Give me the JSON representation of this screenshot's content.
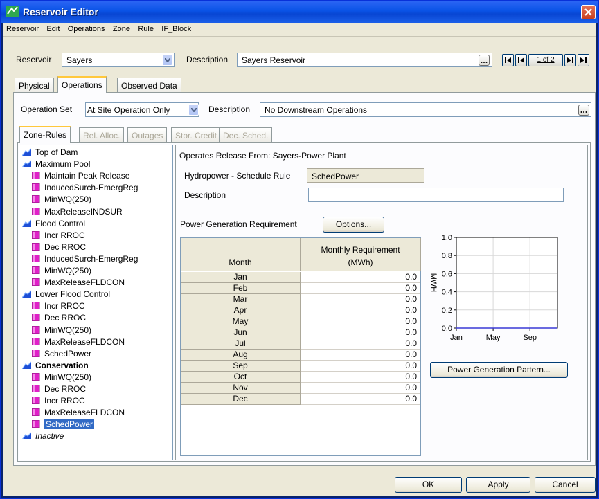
{
  "window": {
    "title": "Reservoir Editor"
  },
  "menu": [
    "Reservoir",
    "Edit",
    "Operations",
    "Zone",
    "Rule",
    "IF_Block"
  ],
  "reservoir": {
    "label": "Reservoir",
    "value": "Sayers",
    "description_label": "Description",
    "description_value": "Sayers Reservoir",
    "nav": {
      "first": "⏮",
      "prev": "◀",
      "page": "1 of 2",
      "next": "▶",
      "last": "⏭"
    }
  },
  "main_tabs": [
    {
      "label": "Physical",
      "active": false
    },
    {
      "label": "Operations",
      "active": true
    },
    {
      "label": "Observed Data",
      "active": false
    }
  ],
  "operation_set": {
    "label": "Operation Set",
    "value": "At Site Operation Only",
    "description_label": "Description",
    "description_value": "No Downstream Operations"
  },
  "sub_tabs": [
    {
      "label": "Zone-Rules",
      "active": true,
      "enabled": true
    },
    {
      "label": "Rel. Alloc.",
      "active": false,
      "enabled": false
    },
    {
      "label": "Outages",
      "active": false,
      "enabled": false
    },
    {
      "label": "Stor. Credit",
      "active": false,
      "enabled": false
    },
    {
      "label": "Dec. Sched.",
      "active": false,
      "enabled": false
    }
  ],
  "tree": [
    {
      "type": "zone",
      "label": "Top of Dam"
    },
    {
      "type": "zone",
      "label": "Maximum Pool"
    },
    {
      "type": "rule",
      "label": "Maintain Peak Release"
    },
    {
      "type": "rule",
      "label": "InducedSurch-EmergReg"
    },
    {
      "type": "rule",
      "label": "MinWQ(250)"
    },
    {
      "type": "rule",
      "label": "MaxReleaseINDSUR"
    },
    {
      "type": "zone",
      "label": "Flood Control"
    },
    {
      "type": "rule",
      "label": "Incr RROC"
    },
    {
      "type": "rule",
      "label": "Dec RROC"
    },
    {
      "type": "rule",
      "label": "InducedSurch-EmergReg"
    },
    {
      "type": "rule",
      "label": "MinWQ(250)"
    },
    {
      "type": "rule",
      "label": "MaxReleaseFLDCON"
    },
    {
      "type": "zone",
      "label": "Lower Flood Control"
    },
    {
      "type": "rule",
      "label": "Incr RROC"
    },
    {
      "type": "rule",
      "label": "Dec RROC"
    },
    {
      "type": "rule",
      "label": "MinWQ(250)"
    },
    {
      "type": "rule",
      "label": "MaxReleaseFLDCON"
    },
    {
      "type": "rule",
      "label": "SchedPower"
    },
    {
      "type": "zone",
      "label": "Conservation",
      "bold": true
    },
    {
      "type": "rule",
      "label": "MinWQ(250)"
    },
    {
      "type": "rule",
      "label": "Dec RROC"
    },
    {
      "type": "rule",
      "label": "Incr RROC"
    },
    {
      "type": "rule",
      "label": "MaxReleaseFLDCON"
    },
    {
      "type": "rule",
      "label": "SchedPower",
      "selected": true
    },
    {
      "type": "zone",
      "label": "Inactive",
      "italic": true
    }
  ],
  "rule_panel": {
    "operates_release_from": "Operates Release From: Sayers-Power Plant",
    "rule_type_label": "Hydropower - Schedule Rule",
    "rule_name": "SchedPower",
    "description_label": "Description",
    "description_value": "",
    "power_req_label": "Power Generation Requirement",
    "options_button": "Options...",
    "pattern_button": "Power Generation Pattern..."
  },
  "table": {
    "col_month": "Month",
    "col_req_line1": "Monthly Requirement",
    "col_req_line2": "(MWh)",
    "rows": [
      {
        "month": "Jan",
        "value": "0.0"
      },
      {
        "month": "Feb",
        "value": "0.0"
      },
      {
        "month": "Mar",
        "value": "0.0"
      },
      {
        "month": "Apr",
        "value": "0.0"
      },
      {
        "month": "May",
        "value": "0.0"
      },
      {
        "month": "Jun",
        "value": "0.0"
      },
      {
        "month": "Jul",
        "value": "0.0"
      },
      {
        "month": "Aug",
        "value": "0.0"
      },
      {
        "month": "Sep",
        "value": "0.0"
      },
      {
        "month": "Oct",
        "value": "0.0"
      },
      {
        "month": "Nov",
        "value": "0.0"
      },
      {
        "month": "Dec",
        "value": "0.0"
      }
    ]
  },
  "chart_data": {
    "type": "line",
    "ylabel": "MWH",
    "ylim": [
      0,
      1.0
    ],
    "y_ticks": [
      "0.0",
      "0.2",
      "0.4",
      "0.6",
      "0.8",
      "1.0"
    ],
    "x_ticks": [
      "Jan",
      "May",
      "Sep"
    ],
    "x": [
      "Jan",
      "Feb",
      "Mar",
      "Apr",
      "May",
      "Jun",
      "Jul",
      "Aug",
      "Sep",
      "Oct",
      "Nov",
      "Dec"
    ],
    "values": [
      0,
      0,
      0,
      0,
      0,
      0,
      0,
      0,
      0,
      0,
      0,
      0
    ],
    "grid": true,
    "line_color": "#3a3ad6"
  },
  "footer": {
    "ok": "OK",
    "apply": "Apply",
    "cancel": "Cancel"
  }
}
